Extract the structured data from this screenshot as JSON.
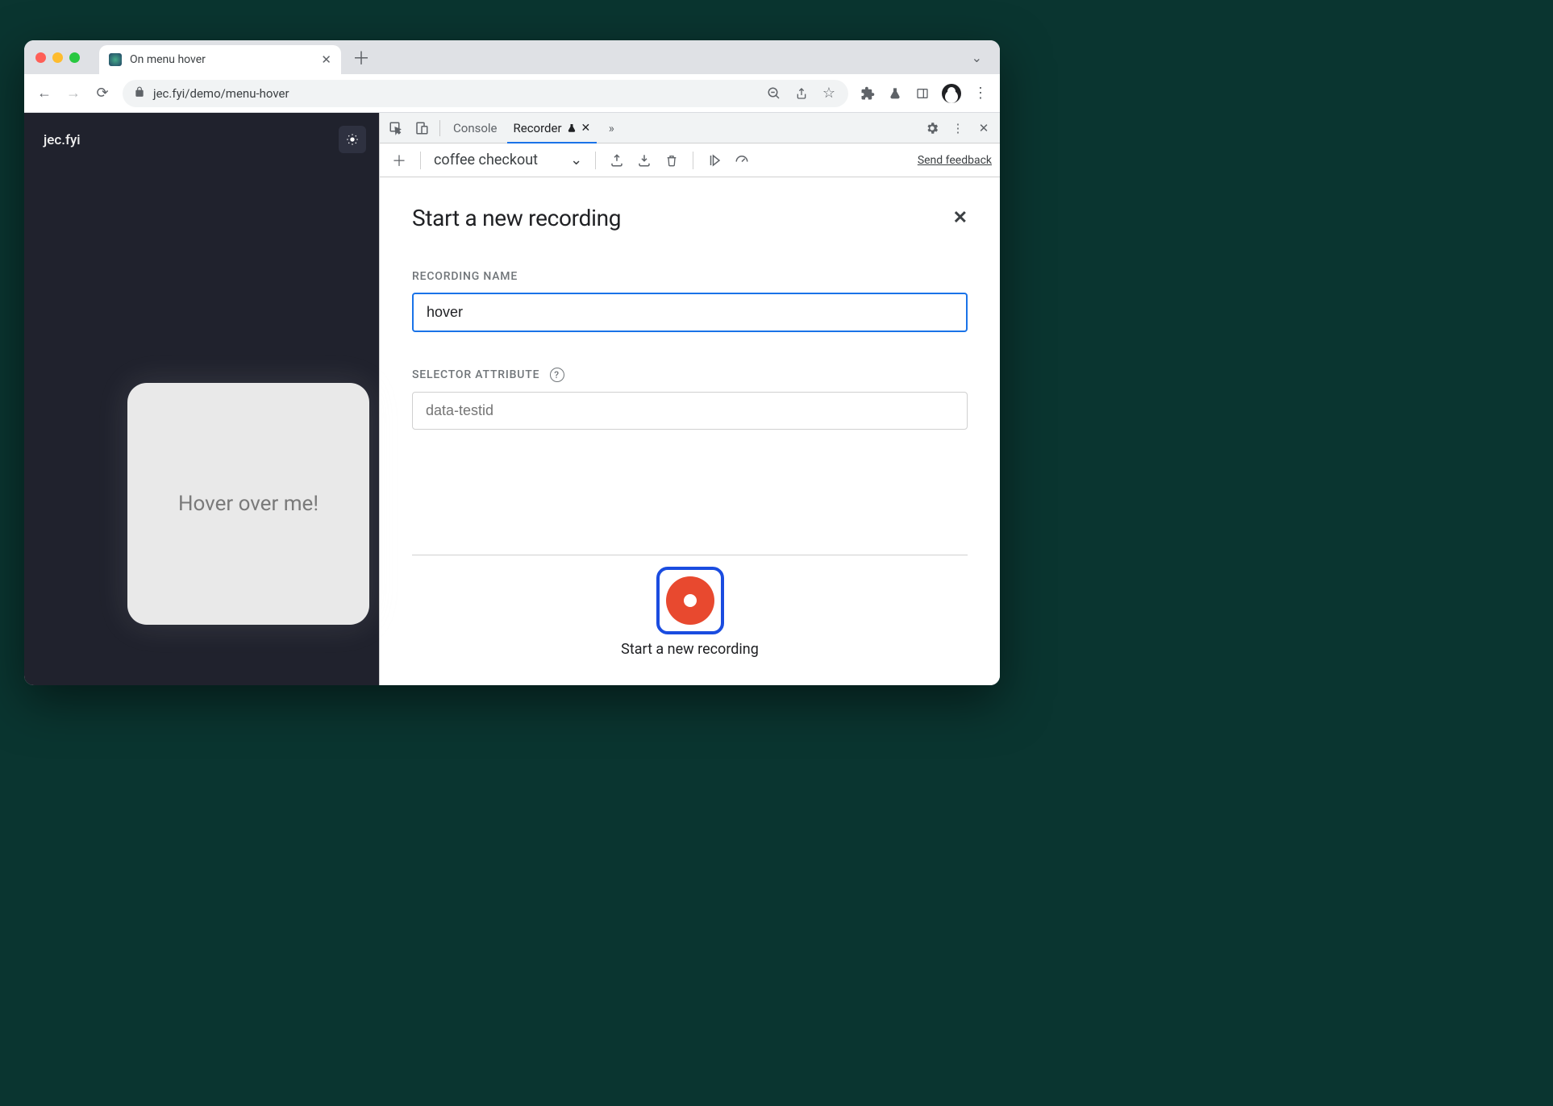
{
  "browser": {
    "tab_title": "On menu hover",
    "url": "jec.fyi/demo/menu-hover"
  },
  "page": {
    "site_title": "jec.fyi",
    "card_text": "Hover over me!"
  },
  "devtools": {
    "tabs": {
      "console": "Console",
      "recorder": "Recorder"
    },
    "recorder": {
      "selected_recording": "coffee checkout",
      "feedback": "Send feedback",
      "title": "Start a new recording",
      "recording_name_label": "RECORDING NAME",
      "recording_name_value": "hover",
      "selector_label": "SELECTOR ATTRIBUTE",
      "selector_placeholder": "data-testid",
      "record_button_label": "Start a new recording"
    }
  }
}
